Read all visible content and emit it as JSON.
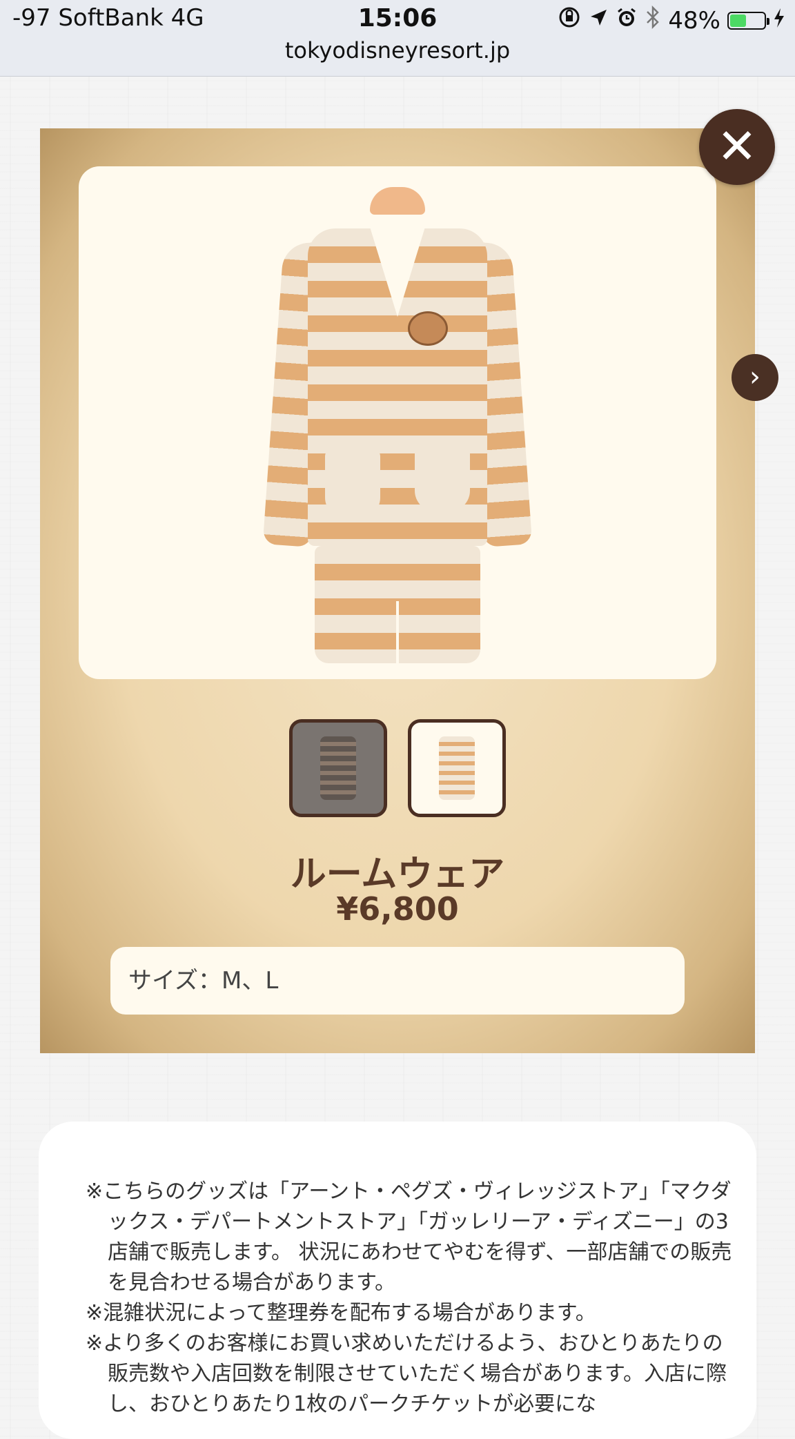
{
  "status_bar": {
    "carrier": "-97 SoftBank   4G",
    "time": "15:06",
    "battery_percent": "48%",
    "battery_level": 0.48,
    "url": "tokyodisneyresort.jp"
  },
  "product": {
    "close_icon": "✕",
    "next_icon": "›",
    "thumbnails": [
      "room-wear-front",
      "room-wear-pajama"
    ],
    "active_thumbnail": 0,
    "name": "ルームウェア",
    "price": "¥6,800",
    "size": "サイズ：M、L"
  },
  "notes": [
    "※こちらのグッズは「アーント・ペグズ・ヴィレッジストア」「マクダックス・デパートメントストア」「ガッレリーア・ディズニー」の3店舗で販売します。 状況にあわせてやむを得ず、一部店舗での販売を見合わせる場合があります。",
    "※混雑状況によって整理券を配布する場合があります。",
    "※より多くのお客様にお買い求めいただけるよう、おひとりあたりの販売数や入店回数を制限させていただく場合があります。入店に際し、おひとりあたり1枚のパークチケットが必要にな"
  ],
  "colors": {
    "brown": "#4a2e22",
    "title_brown": "#5a3a28",
    "card_tan": "#eed7ad",
    "cream": "#fffaee"
  }
}
